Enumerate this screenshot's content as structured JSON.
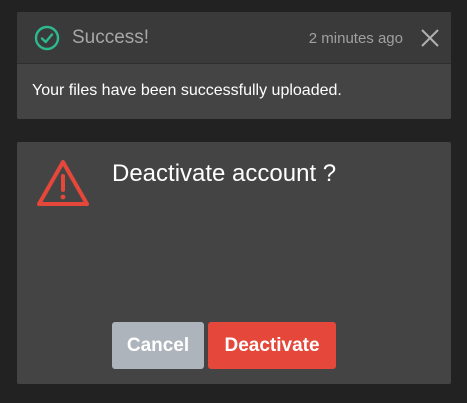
{
  "toast": {
    "icon": "check-circle-icon",
    "title": "Success!",
    "time": "2 minutes ago",
    "close_icon": "close-icon",
    "message": "Your files have been successfully uploaded.",
    "accent_color": "#2db98e"
  },
  "modal": {
    "icon": "warning-triangle-icon",
    "title": "Deactivate account ?",
    "cancel_label": "Cancel",
    "confirm_label": "Deactivate",
    "warning_color": "#e5473b",
    "cancel_color": "#adb4bb"
  },
  "colors": {
    "background": "#222222",
    "panel": "#444444",
    "toast_header": "#3a3a3a"
  }
}
